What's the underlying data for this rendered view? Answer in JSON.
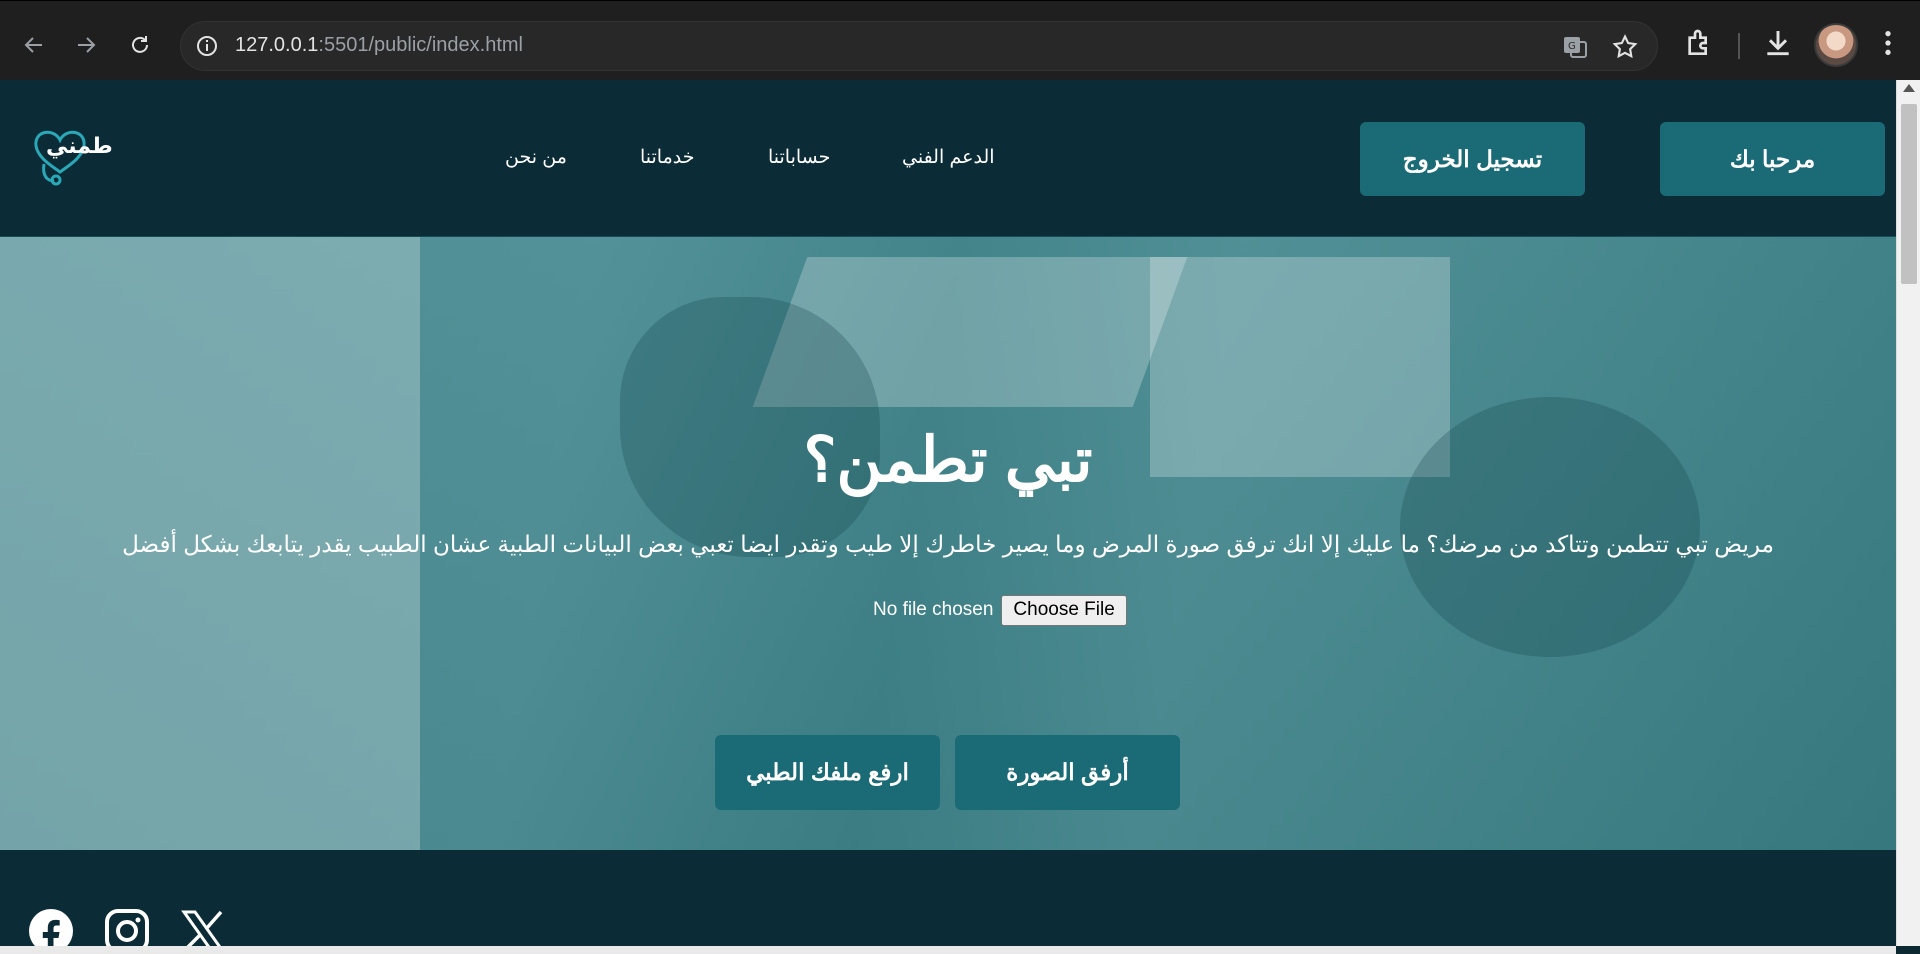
{
  "browser": {
    "url_host": "127.0.0.1",
    "url_rest": ":5501/public/index.html"
  },
  "site": {
    "logo_text": "طمني",
    "nav": {
      "about": "من نحن",
      "services": "خدماتنا",
      "accounts": "حساباتنا",
      "support": "الدعم الفني"
    },
    "logout_label": "تسجيل الخروج",
    "welcome_label": "مرحبا بك"
  },
  "hero": {
    "title": "تبي تطمن؟",
    "subtitle": "مريض تبي تتطمن وتتاكد من مرضك؟ ما عليك إلا انك ترفق صورة المرض وما يصير خاطرك إلا طيب وتقدر ايضا تعبي بعض البيانات الطبية عشان الطبيب يقدر يتابعك بشكل أفضل",
    "file_status": "No file chosen",
    "choose_file_label": "Choose File",
    "attach_image_label": "أرفق الصورة",
    "upload_file_label": "ارفع ملفك الطبي"
  },
  "footer": {
    "social": [
      "facebook-icon",
      "instagram-icon",
      "x-icon"
    ]
  },
  "colors": {
    "header_bg": "#0b2c36",
    "button_bg": "#1b6b77",
    "hero_overlay": "#287880"
  }
}
